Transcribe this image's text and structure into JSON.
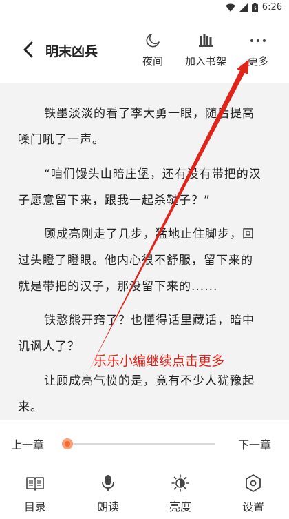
{
  "status_bar": {
    "time": "6:26"
  },
  "header": {
    "title": "明末凶兵",
    "night_label": "夜间",
    "shelf_label": "加入书架",
    "more_label": "更多"
  },
  "content": {
    "paragraphs": [
      [
        "铁墨淡淡的看了李大勇一眼，随后提高",
        "嗓门吼了一声。"
      ],
      [
        "“咱们馒头山暗庄堡，还有没有带把的汉",
        "子愿意留下来，跟我一起杀鞑子？”"
      ],
      [
        "顾成亮刚走了几步，猛地止住脚步，回",
        "过头瞪了瞪眼。他内心很不舒服，留下来的",
        "就是带把的汉子，那没留下来的......"
      ],
      [
        "铁憨熊开窍了？也懂得话里藏话，暗中",
        "讥讽人了？"
      ],
      [
        "让顾成亮气愤的是，竟有不少人犹豫起",
        "来。"
      ]
    ]
  },
  "annotation": {
    "text": "乐乐小编继续点击更多",
    "color": "#e0241a"
  },
  "chapter_nav": {
    "prev_label": "上一章",
    "next_label": "下一章",
    "progress": 0.0
  },
  "bottom_nav": {
    "toc_label": "目录",
    "read_aloud_label": "朗读",
    "brightness_label": "亮度",
    "settings_label": "设置"
  },
  "colors": {
    "accent": "#f26b2a",
    "annotation": "#e0241a"
  }
}
